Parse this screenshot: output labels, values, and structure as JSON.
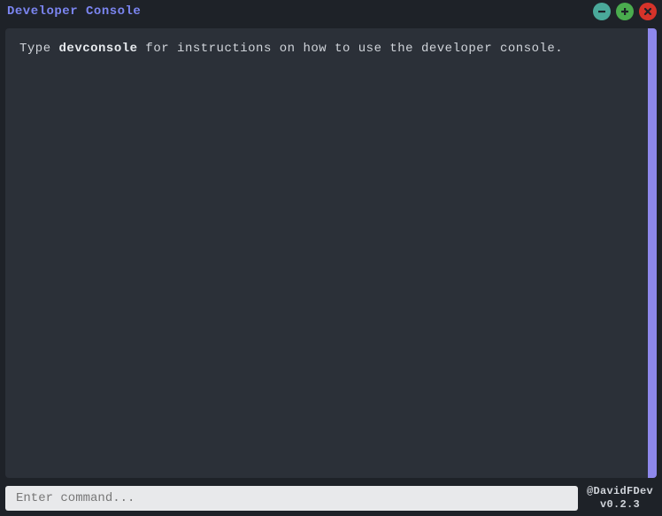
{
  "window": {
    "title": "Developer Console"
  },
  "console": {
    "hint_prefix": "Type ",
    "hint_command": "devconsole",
    "hint_suffix": " for instructions on how to use the developer console."
  },
  "input": {
    "placeholder": "Enter command..."
  },
  "footer": {
    "author": "@DavidFDev",
    "version": "v0.2.3"
  }
}
